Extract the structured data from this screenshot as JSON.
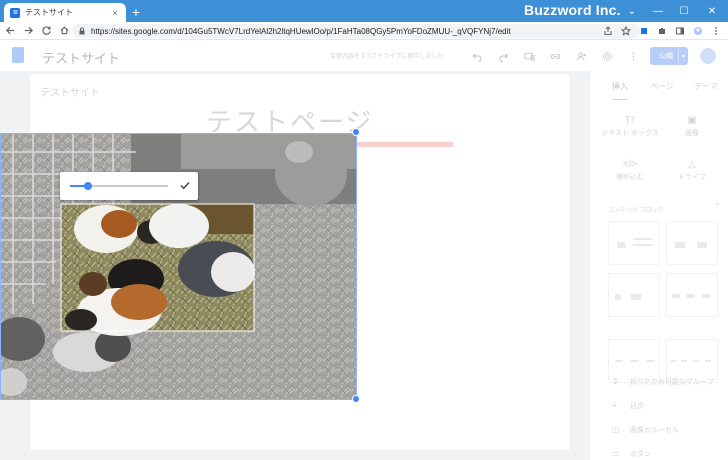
{
  "browser": {
    "tab_title": "テストサイト",
    "tab_close": "×",
    "new_tab": "+",
    "brand": "Buzzword Inc.",
    "url": "https://sites.google.com/d/104Gu5TWcV7LrdYelAl2h2ltqHUewlOo/p/1FaHTa08QGy5PmYoFDoZMUU-_qVQFYNj7/edit",
    "window_controls": [
      "⌄",
      "—",
      "☐",
      "✕"
    ]
  },
  "app": {
    "site_title": "テストサイト",
    "draft_note": "変更内容をすべてドライブに保存しました",
    "publish_label": "公開",
    "publish_chevron": "▾"
  },
  "page": {
    "page_name": "テストサイト",
    "hero_text": "テストページ"
  },
  "side_panel": {
    "tabs": [
      "挿入",
      "ページ",
      "テーマ"
    ],
    "insert_items": [
      {
        "glyph": "Tт",
        "label": "テキスト ボックス"
      },
      {
        "glyph": "▣",
        "label": "画像"
      },
      {
        "glyph": "</>",
        "label": "埋め込む"
      },
      {
        "glyph": "△",
        "label": "ドライブ"
      }
    ],
    "section_title": "コンテンツ ブロック",
    "section_chevron": "⌃",
    "list_items": [
      {
        "glyph": "⇕",
        "label": "折りたたみ可能なグループ"
      },
      {
        "glyph": "≡",
        "label": "目次"
      },
      {
        "glyph": "◫",
        "label": "画像カルーセル"
      },
      {
        "glyph": "▭",
        "label": "ボタン"
      }
    ]
  },
  "crop": {
    "zoom_level": 0.18,
    "confirm_icon": "check-icon"
  },
  "colors": {
    "accent": "#4285f4",
    "titlebar": "#3d8fd6"
  }
}
